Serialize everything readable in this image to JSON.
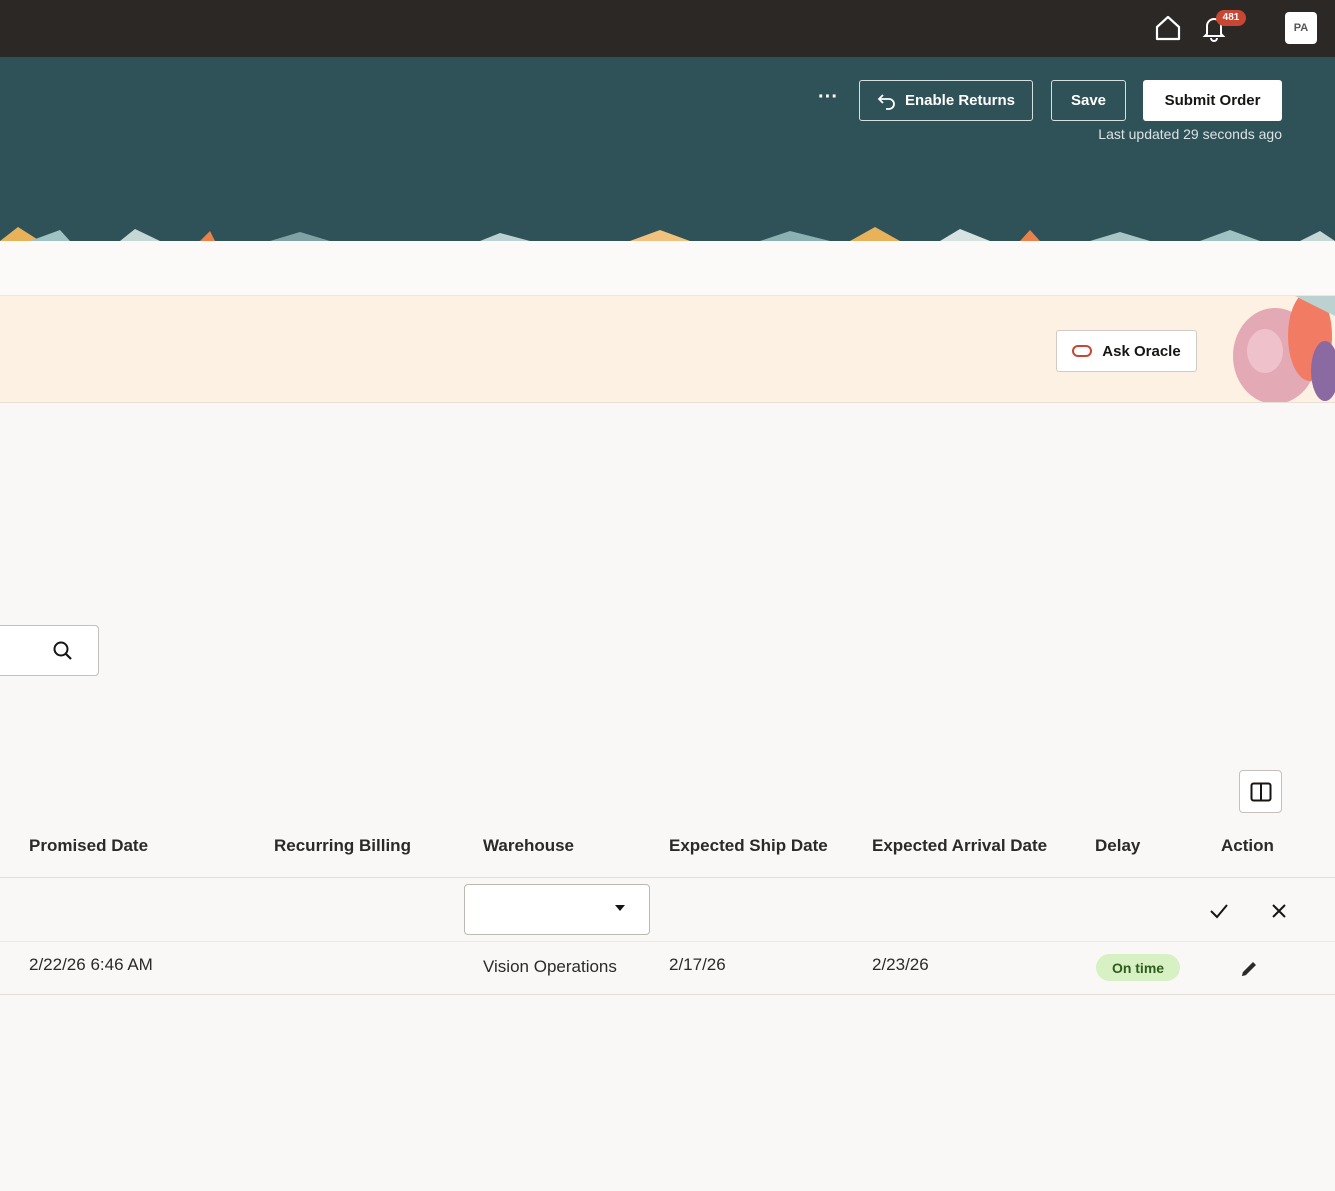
{
  "topbar": {
    "home_icon": "home-icon",
    "notifications": {
      "icon": "bell-icon",
      "badge": "481"
    },
    "avatar": "PA"
  },
  "header": {
    "more_icon": "ellipsis-icon",
    "more_label": "···",
    "enable_returns_label": "Enable Returns",
    "save_label": "Save",
    "submit_label": "Submit Order",
    "last_updated": "Last updated 29 seconds ago",
    "background_color": "#2f5158"
  },
  "banner": {
    "ask_oracle_label": "Ask Oracle",
    "background_color": "#fcf1e3"
  },
  "search": {
    "value": "",
    "icon": "search-icon"
  },
  "table": {
    "columns": [
      "Promised Date",
      "Recurring Billing",
      "Warehouse",
      "Expected Ship Date",
      "Expected Arrival Date",
      "Delay",
      "Action"
    ],
    "edit_row": {
      "warehouse_value": ""
    },
    "rows": [
      {
        "promised_date": "2/22/26 6:46 AM",
        "recurring_billing": "",
        "warehouse": "Vision Operations",
        "expected_ship_date": "2/17/26",
        "expected_arrival_date": "2/23/26",
        "delay": "On time"
      }
    ]
  }
}
